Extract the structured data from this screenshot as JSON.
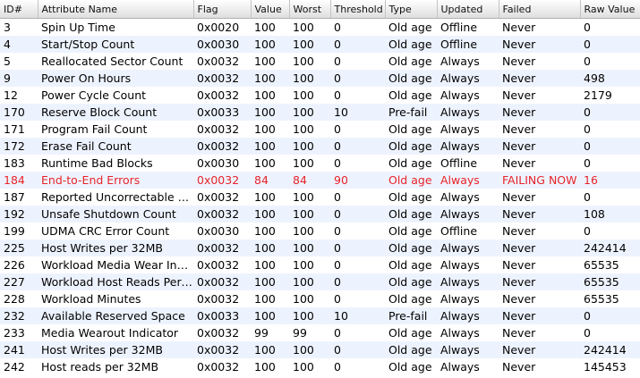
{
  "columns": [
    "ID#",
    "Attribute Name",
    "Flag",
    "Value",
    "Worst",
    "Threshold",
    "Type",
    "Updated",
    "Failed",
    "Raw Value"
  ],
  "rows": [
    {
      "id": "3",
      "name": "Spin Up Time",
      "flag": "0x0020",
      "value": "100",
      "worst": "100",
      "threshold": "0",
      "type": "Old age",
      "updated": "Offline",
      "failed": "Never",
      "raw": "0",
      "failing": false
    },
    {
      "id": "4",
      "name": "Start/Stop Count",
      "flag": "0x0030",
      "value": "100",
      "worst": "100",
      "threshold": "0",
      "type": "Old age",
      "updated": "Offline",
      "failed": "Never",
      "raw": "0",
      "failing": false
    },
    {
      "id": "5",
      "name": "Reallocated Sector Count",
      "flag": "0x0032",
      "value": "100",
      "worst": "100",
      "threshold": "0",
      "type": "Old age",
      "updated": "Always",
      "failed": "Never",
      "raw": "0",
      "failing": false
    },
    {
      "id": "9",
      "name": "Power On Hours",
      "flag": "0x0032",
      "value": "100",
      "worst": "100",
      "threshold": "0",
      "type": "Old age",
      "updated": "Always",
      "failed": "Never",
      "raw": "498",
      "failing": false
    },
    {
      "id": "12",
      "name": "Power Cycle Count",
      "flag": "0x0032",
      "value": "100",
      "worst": "100",
      "threshold": "0",
      "type": "Old age",
      "updated": "Always",
      "failed": "Never",
      "raw": "2179",
      "failing": false
    },
    {
      "id": "170",
      "name": "Reserve Block Count",
      "flag": "0x0033",
      "value": "100",
      "worst": "100",
      "threshold": "10",
      "type": "Pre-fail",
      "updated": "Always",
      "failed": "Never",
      "raw": "0",
      "failing": false
    },
    {
      "id": "171",
      "name": "Program Fail Count",
      "flag": "0x0032",
      "value": "100",
      "worst": "100",
      "threshold": "0",
      "type": "Old age",
      "updated": "Always",
      "failed": "Never",
      "raw": "0",
      "failing": false
    },
    {
      "id": "172",
      "name": "Erase Fail Count",
      "flag": "0x0032",
      "value": "100",
      "worst": "100",
      "threshold": "0",
      "type": "Old age",
      "updated": "Always",
      "failed": "Never",
      "raw": "0",
      "failing": false
    },
    {
      "id": "183",
      "name": "Runtime Bad Blocks",
      "flag": "0x0030",
      "value": "100",
      "worst": "100",
      "threshold": "0",
      "type": "Old age",
      "updated": "Offline",
      "failed": "Never",
      "raw": "0",
      "failing": false
    },
    {
      "id": "184",
      "name": "End-to-End Errors",
      "flag": "0x0032",
      "value": "84",
      "worst": "84",
      "threshold": "90",
      "type": "Old age",
      "updated": "Always",
      "failed": "FAILING NOW",
      "raw": "16",
      "failing": true
    },
    {
      "id": "187",
      "name": "Reported Uncorrectable Errors",
      "flag": "0x0032",
      "value": "100",
      "worst": "100",
      "threshold": "0",
      "type": "Old age",
      "updated": "Always",
      "failed": "Never",
      "raw": "0",
      "failing": false
    },
    {
      "id": "192",
      "name": "Unsafe Shutdown Count",
      "flag": "0x0032",
      "value": "100",
      "worst": "100",
      "threshold": "0",
      "type": "Old age",
      "updated": "Always",
      "failed": "Never",
      "raw": "108",
      "failing": false
    },
    {
      "id": "199",
      "name": "UDMA CRC Error Count",
      "flag": "0x0030",
      "value": "100",
      "worst": "100",
      "threshold": "0",
      "type": "Old age",
      "updated": "Offline",
      "failed": "Never",
      "raw": "0",
      "failing": false
    },
    {
      "id": "225",
      "name": "Host Writes per 32MB",
      "flag": "0x0032",
      "value": "100",
      "worst": "100",
      "threshold": "0",
      "type": "Old age",
      "updated": "Always",
      "failed": "Never",
      "raw": "242414",
      "failing": false
    },
    {
      "id": "226",
      "name": "Workload Media Wear Indicator",
      "flag": "0x0032",
      "value": "100",
      "worst": "100",
      "threshold": "0",
      "type": "Old age",
      "updated": "Always",
      "failed": "Never",
      "raw": "65535",
      "failing": false
    },
    {
      "id": "227",
      "name": "Workload Host Reads Percentage",
      "flag": "0x0032",
      "value": "100",
      "worst": "100",
      "threshold": "0",
      "type": "Old age",
      "updated": "Always",
      "failed": "Never",
      "raw": "65535",
      "failing": false
    },
    {
      "id": "228",
      "name": "Workload Minutes",
      "flag": "0x0032",
      "value": "100",
      "worst": "100",
      "threshold": "0",
      "type": "Old age",
      "updated": "Always",
      "failed": "Never",
      "raw": "65535",
      "failing": false
    },
    {
      "id": "232",
      "name": "Available Reserved Space",
      "flag": "0x0033",
      "value": "100",
      "worst": "100",
      "threshold": "10",
      "type": "Pre-fail",
      "updated": "Always",
      "failed": "Never",
      "raw": "0",
      "failing": false
    },
    {
      "id": "233",
      "name": "Media Wearout Indicator",
      "flag": "0x0032",
      "value": "99",
      "worst": "99",
      "threshold": "0",
      "type": "Old age",
      "updated": "Always",
      "failed": "Never",
      "raw": "0",
      "failing": false
    },
    {
      "id": "241",
      "name": "Host Writes per 32MB",
      "flag": "0x0032",
      "value": "100",
      "worst": "100",
      "threshold": "0",
      "type": "Old age",
      "updated": "Always",
      "failed": "Never",
      "raw": "242414",
      "failing": false
    },
    {
      "id": "242",
      "name": "Host reads per 32MB",
      "flag": "0x0032",
      "value": "100",
      "worst": "100",
      "threshold": "0",
      "type": "Old age",
      "updated": "Always",
      "failed": "Never",
      "raw": "145453",
      "failing": false
    }
  ],
  "colors": {
    "row_alt": "#edf3fe",
    "row": "#ffffff",
    "failing_text": "#e8232a",
    "header_bg": "#e4e4e4"
  }
}
